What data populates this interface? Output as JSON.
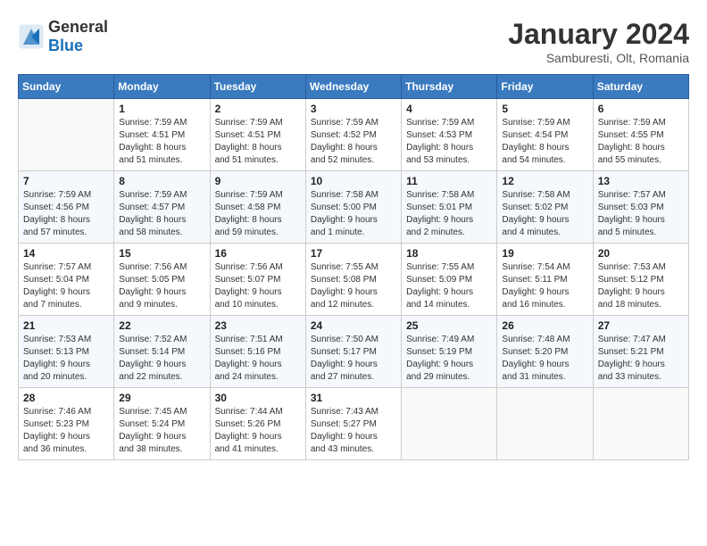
{
  "header": {
    "logo_general": "General",
    "logo_blue": "Blue",
    "title": "January 2024",
    "subtitle": "Samburesti, Olt, Romania"
  },
  "weekdays": [
    "Sunday",
    "Monday",
    "Tuesday",
    "Wednesday",
    "Thursday",
    "Friday",
    "Saturday"
  ],
  "weeks": [
    [
      {
        "day": "",
        "info": ""
      },
      {
        "day": "1",
        "info": "Sunrise: 7:59 AM\nSunset: 4:51 PM\nDaylight: 8 hours\nand 51 minutes."
      },
      {
        "day": "2",
        "info": "Sunrise: 7:59 AM\nSunset: 4:51 PM\nDaylight: 8 hours\nand 51 minutes."
      },
      {
        "day": "3",
        "info": "Sunrise: 7:59 AM\nSunset: 4:52 PM\nDaylight: 8 hours\nand 52 minutes."
      },
      {
        "day": "4",
        "info": "Sunrise: 7:59 AM\nSunset: 4:53 PM\nDaylight: 8 hours\nand 53 minutes."
      },
      {
        "day": "5",
        "info": "Sunrise: 7:59 AM\nSunset: 4:54 PM\nDaylight: 8 hours\nand 54 minutes."
      },
      {
        "day": "6",
        "info": "Sunrise: 7:59 AM\nSunset: 4:55 PM\nDaylight: 8 hours\nand 55 minutes."
      }
    ],
    [
      {
        "day": "7",
        "info": "Sunrise: 7:59 AM\nSunset: 4:56 PM\nDaylight: 8 hours\nand 57 minutes."
      },
      {
        "day": "8",
        "info": "Sunrise: 7:59 AM\nSunset: 4:57 PM\nDaylight: 8 hours\nand 58 minutes."
      },
      {
        "day": "9",
        "info": "Sunrise: 7:59 AM\nSunset: 4:58 PM\nDaylight: 8 hours\nand 59 minutes."
      },
      {
        "day": "10",
        "info": "Sunrise: 7:58 AM\nSunset: 5:00 PM\nDaylight: 9 hours\nand 1 minute."
      },
      {
        "day": "11",
        "info": "Sunrise: 7:58 AM\nSunset: 5:01 PM\nDaylight: 9 hours\nand 2 minutes."
      },
      {
        "day": "12",
        "info": "Sunrise: 7:58 AM\nSunset: 5:02 PM\nDaylight: 9 hours\nand 4 minutes."
      },
      {
        "day": "13",
        "info": "Sunrise: 7:57 AM\nSunset: 5:03 PM\nDaylight: 9 hours\nand 5 minutes."
      }
    ],
    [
      {
        "day": "14",
        "info": "Sunrise: 7:57 AM\nSunset: 5:04 PM\nDaylight: 9 hours\nand 7 minutes."
      },
      {
        "day": "15",
        "info": "Sunrise: 7:56 AM\nSunset: 5:05 PM\nDaylight: 9 hours\nand 9 minutes."
      },
      {
        "day": "16",
        "info": "Sunrise: 7:56 AM\nSunset: 5:07 PM\nDaylight: 9 hours\nand 10 minutes."
      },
      {
        "day": "17",
        "info": "Sunrise: 7:55 AM\nSunset: 5:08 PM\nDaylight: 9 hours\nand 12 minutes."
      },
      {
        "day": "18",
        "info": "Sunrise: 7:55 AM\nSunset: 5:09 PM\nDaylight: 9 hours\nand 14 minutes."
      },
      {
        "day": "19",
        "info": "Sunrise: 7:54 AM\nSunset: 5:11 PM\nDaylight: 9 hours\nand 16 minutes."
      },
      {
        "day": "20",
        "info": "Sunrise: 7:53 AM\nSunset: 5:12 PM\nDaylight: 9 hours\nand 18 minutes."
      }
    ],
    [
      {
        "day": "21",
        "info": "Sunrise: 7:53 AM\nSunset: 5:13 PM\nDaylight: 9 hours\nand 20 minutes."
      },
      {
        "day": "22",
        "info": "Sunrise: 7:52 AM\nSunset: 5:14 PM\nDaylight: 9 hours\nand 22 minutes."
      },
      {
        "day": "23",
        "info": "Sunrise: 7:51 AM\nSunset: 5:16 PM\nDaylight: 9 hours\nand 24 minutes."
      },
      {
        "day": "24",
        "info": "Sunrise: 7:50 AM\nSunset: 5:17 PM\nDaylight: 9 hours\nand 27 minutes."
      },
      {
        "day": "25",
        "info": "Sunrise: 7:49 AM\nSunset: 5:19 PM\nDaylight: 9 hours\nand 29 minutes."
      },
      {
        "day": "26",
        "info": "Sunrise: 7:48 AM\nSunset: 5:20 PM\nDaylight: 9 hours\nand 31 minutes."
      },
      {
        "day": "27",
        "info": "Sunrise: 7:47 AM\nSunset: 5:21 PM\nDaylight: 9 hours\nand 33 minutes."
      }
    ],
    [
      {
        "day": "28",
        "info": "Sunrise: 7:46 AM\nSunset: 5:23 PM\nDaylight: 9 hours\nand 36 minutes."
      },
      {
        "day": "29",
        "info": "Sunrise: 7:45 AM\nSunset: 5:24 PM\nDaylight: 9 hours\nand 38 minutes."
      },
      {
        "day": "30",
        "info": "Sunrise: 7:44 AM\nSunset: 5:26 PM\nDaylight: 9 hours\nand 41 minutes."
      },
      {
        "day": "31",
        "info": "Sunrise: 7:43 AM\nSunset: 5:27 PM\nDaylight: 9 hours\nand 43 minutes."
      },
      {
        "day": "",
        "info": ""
      },
      {
        "day": "",
        "info": ""
      },
      {
        "day": "",
        "info": ""
      }
    ]
  ]
}
